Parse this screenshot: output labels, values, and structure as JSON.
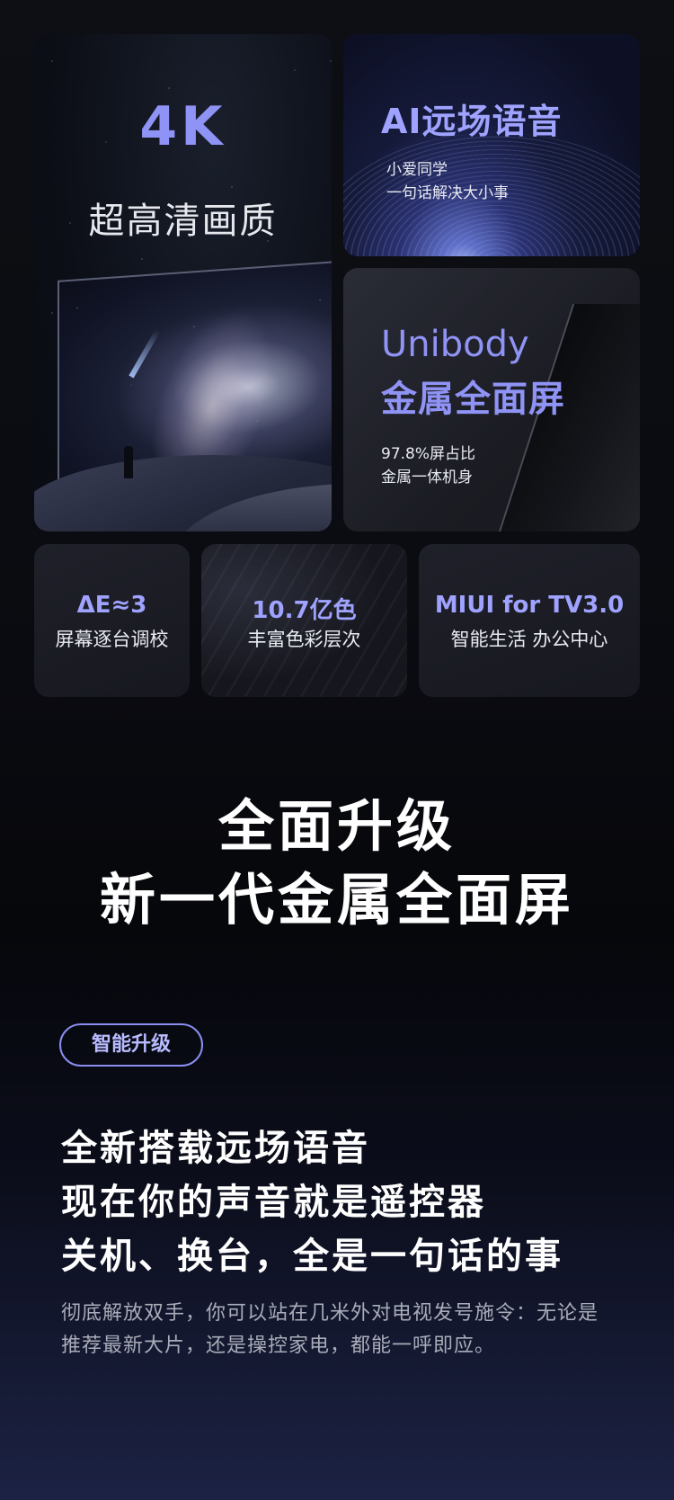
{
  "card_4k": {
    "title": "4K",
    "subtitle": "超高清画质"
  },
  "card_ai": {
    "title": "AI远场语音",
    "line1": "小爱同学",
    "line2": "一句话解决大小事"
  },
  "card_unibody": {
    "title1": "Unibody",
    "title2": "金属全面屏",
    "line1": "97.8%屏占比",
    "line2": "金属一体机身"
  },
  "small_cards": [
    {
      "title": "ΔE≈3",
      "subtitle": "屏幕逐台调校"
    },
    {
      "title": "10.7亿色",
      "subtitle": "丰富色彩层次"
    },
    {
      "title": "MIUI for TV3.0",
      "subtitle": "智能生活 办公中心"
    }
  ],
  "headline": {
    "line1": "全面升级",
    "line2": "新一代金属全面屏"
  },
  "section": {
    "badge": "智能升级",
    "lines": [
      "全新搭载远场语音",
      "现在你的声音就是遥控器",
      "关机、换台，全是一句话的事"
    ],
    "desc": [
      "彻底解放双手，你可以站在几米外对电视发号施令：无论是",
      "推荐最新大片，还是操控家电，都能一呼即应。"
    ]
  },
  "colors": {
    "accent": "#8f93f5",
    "background": "#0a0b10"
  }
}
